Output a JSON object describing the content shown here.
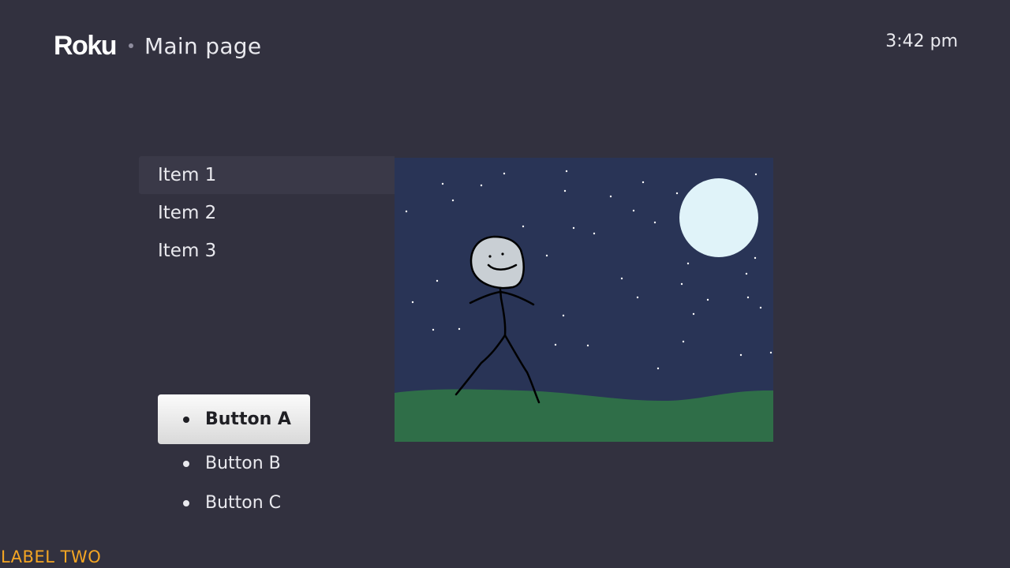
{
  "header": {
    "logo": "Roku",
    "title": "Main page",
    "clock": "3:42 pm"
  },
  "list": {
    "items": [
      {
        "label": "Item 1",
        "focused": true
      },
      {
        "label": "Item 2",
        "focused": false
      },
      {
        "label": "Item 3",
        "focused": false
      }
    ]
  },
  "buttons": {
    "items": [
      {
        "label": "Button A",
        "focused": true
      },
      {
        "label": "Button B",
        "focused": false
      },
      {
        "label": "Button C",
        "focused": false
      }
    ]
  },
  "poster": {
    "scene": "stick figure under full moon at night",
    "colors": {
      "sky": "#293456",
      "grass": "#2f6e48",
      "moon": "#e0f3f9"
    }
  },
  "footer": {
    "label": "LABEL TWO",
    "label_color": "#f5a623"
  },
  "colors": {
    "background": "#32313f",
    "text": "#e9e9ee",
    "focus_button": "#f0f0f0"
  }
}
